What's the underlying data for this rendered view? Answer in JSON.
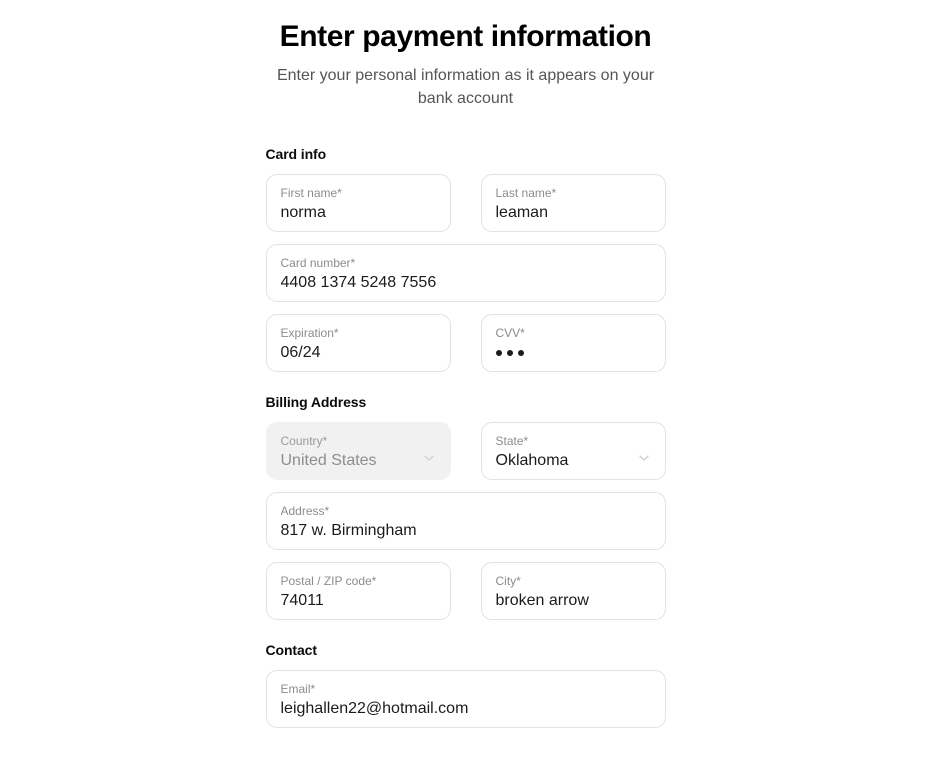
{
  "header": {
    "title": "Enter payment information",
    "subtitle": "Enter your personal information as it appears on your bank account"
  },
  "sections": {
    "card_info": {
      "title": "Card info",
      "first_name": {
        "label": "First name*",
        "value": "norma"
      },
      "last_name": {
        "label": "Last name*",
        "value": "leaman"
      },
      "card_number": {
        "label": "Card number*",
        "value": "4408 1374 5248 7556"
      },
      "expiration": {
        "label": "Expiration*",
        "value": "06/24"
      },
      "cvv": {
        "label": "CVV*",
        "value": "•••",
        "masked_digits": 3
      }
    },
    "billing_address": {
      "title": "Billing Address",
      "country": {
        "label": "Country*",
        "value": "United States",
        "disabled": true,
        "icon": "chevron-down-icon"
      },
      "state": {
        "label": "State*",
        "value": "Oklahoma",
        "icon": "chevron-down-icon"
      },
      "address": {
        "label": "Address*",
        "value": "817 w. Birmingham"
      },
      "postal_code": {
        "label": "Postal / ZIP code*",
        "value": "74011"
      },
      "city": {
        "label": "City*",
        "value": "broken arrow"
      }
    },
    "contact": {
      "title": "Contact",
      "email": {
        "label": "Email*",
        "value": "leighallen22@hotmail.com"
      }
    }
  },
  "colors": {
    "background": "#ffffff",
    "text": "#1b1b1b",
    "label": "#8c8c8c",
    "border": "#e2e2e2",
    "disabled_fill": "#f1f1f1"
  }
}
